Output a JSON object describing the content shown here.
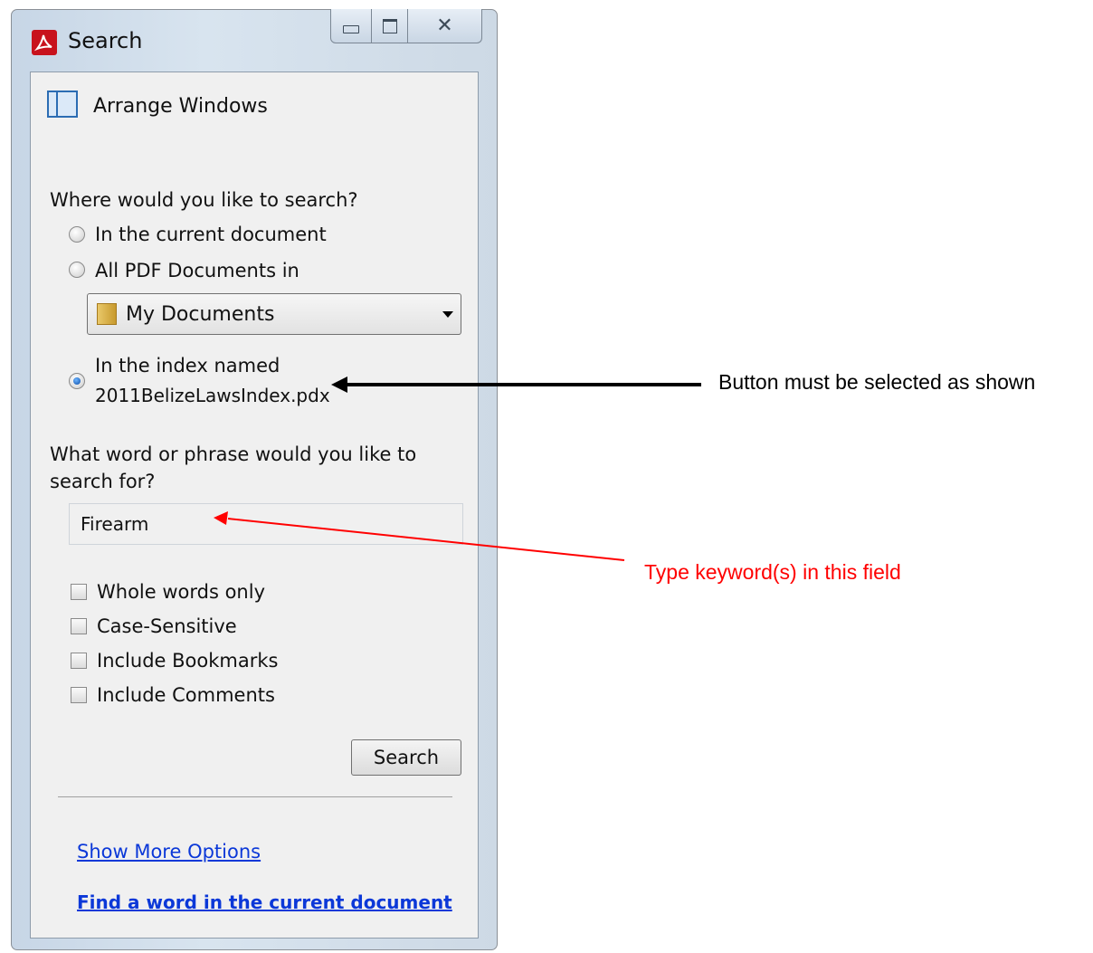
{
  "window": {
    "title": "Search",
    "minimize_icon": "minimize-icon",
    "maximize_icon": "maximize-icon",
    "close_icon": "close-icon"
  },
  "panel": {
    "arrange_windows_label": "Arrange Windows",
    "where_question": "Where would you like to search?",
    "scope_options": [
      {
        "label": "In the current document",
        "selected": false
      },
      {
        "label": "All PDF Documents in",
        "selected": false
      },
      {
        "label_line1": "In the index named",
        "label_line2": "2011BelizeLawsIndex.pdx",
        "selected": true
      }
    ],
    "folder_select": {
      "value": "My Documents"
    },
    "what_question_line1": "What word or phrase would you like to",
    "what_question_line2": "search for?",
    "search_field": {
      "value": "Firearm"
    },
    "checkboxes": [
      {
        "label": "Whole words only",
        "checked": false
      },
      {
        "label": "Case-Sensitive",
        "checked": false
      },
      {
        "label": "Include Bookmarks",
        "checked": false
      },
      {
        "label": "Include Comments",
        "checked": false
      }
    ],
    "search_button": "Search",
    "show_more_options": "Show More Options",
    "find_word_link": "Find a word in the current document"
  },
  "annotations": {
    "radio_note": "Button must be selected as shown",
    "field_note": "Type keyword(s) in this field",
    "radio_note_color": "#000000",
    "field_note_color": "#ff0000"
  }
}
